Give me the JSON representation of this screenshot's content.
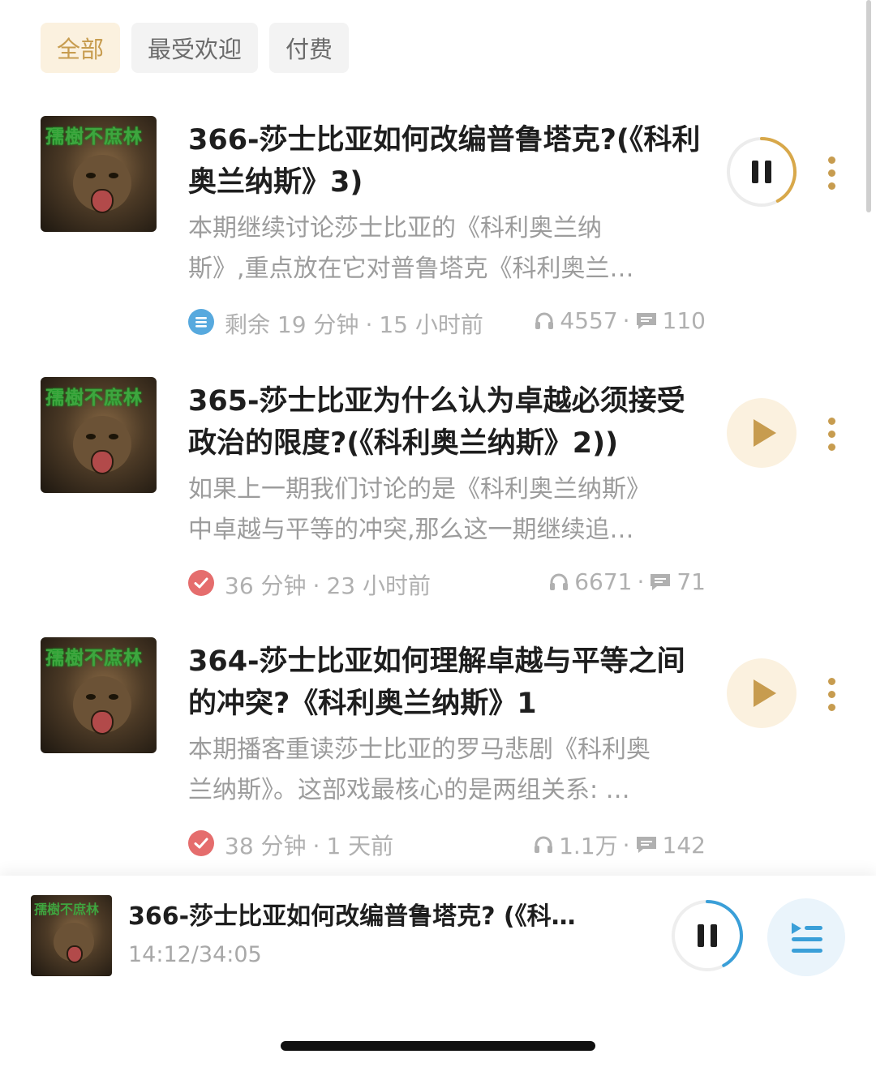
{
  "filters": [
    {
      "label": "全部",
      "active": true
    },
    {
      "label": "最受欢迎",
      "active": false
    },
    {
      "label": "付费",
      "active": false
    }
  ],
  "cover_art_text": "孺樹不庶林",
  "episodes": [
    {
      "title": "366-莎士比亚如何改编普鲁塔克?(《科利奥兰纳斯》3)",
      "desc_line1": "本期继续讨论莎士比亚的《科利奥兰纳",
      "desc_line2": "斯》,重点放在它对普鲁塔克《科利奥兰…",
      "status": "partial",
      "duration": "剩余 19 分钟",
      "sep": "·",
      "time_ago": "15 小时前",
      "plays": "4557",
      "stats_sep": "·",
      "comments": "110",
      "playing": true,
      "progress": 0.42
    },
    {
      "title": "365-莎士比亚为什么认为卓越必须接受政治的限度?(《科利奥兰纳斯》2))",
      "desc_line1": "如果上一期我们讨论的是《科利奥兰纳斯》",
      "desc_line2": "中卓越与平等的冲突,那么这一期继续追…",
      "status": "done",
      "duration": "36 分钟",
      "sep": "·",
      "time_ago": "23 小时前",
      "plays": "6671",
      "stats_sep": "·",
      "comments": "71",
      "playing": false
    },
    {
      "title": "364-莎士比亚如何理解卓越与平等之间的冲突?《科利奥兰纳斯》1",
      "desc_line1": "本期播客重读莎士比亚的罗马悲剧《科利奥",
      "desc_line2": "兰纳斯》。这部戏最核心的是两组关系: …",
      "status": "done",
      "duration": "38 分钟",
      "sep": "·",
      "time_ago": "1 天前",
      "plays": "1.1万",
      "stats_sep": "·",
      "comments": "142",
      "playing": false
    }
  ],
  "now_playing": {
    "title": "366-莎士比亚如何改编普鲁塔克? (《科…",
    "time": "14:12/34:05",
    "progress": 0.42
  },
  "colors": {
    "accent": "#c79c4f",
    "accent_bg": "#fbf1df",
    "blue": "#3a9fd8",
    "done_red": "#e56d6d",
    "partial_blue": "#57a9de"
  }
}
